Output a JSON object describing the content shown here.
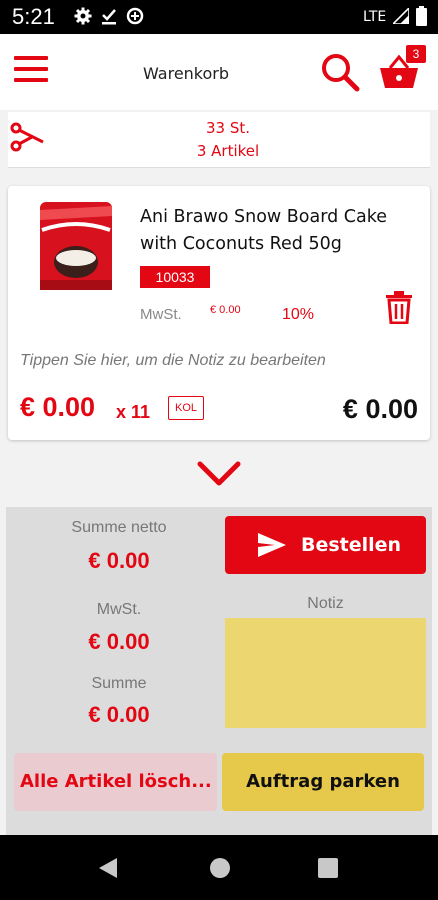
{
  "status_bar": {
    "time": "5:21",
    "network": "LTE"
  },
  "app_bar": {
    "title": "Warenkorb",
    "cart_count": "3"
  },
  "summary": {
    "quantity": "33 St.",
    "articles": "3 Artikel"
  },
  "product": {
    "name": "Ani Brawo Snow Board Cake with Coconuts Red 50g",
    "code": "10033",
    "vat_label": "MwSt.",
    "vat_amount": "€ 0.00",
    "vat_rate": "10%",
    "note_placeholder": "Tippen Sie hier, um die Notiz zu bearbeiten",
    "unit_price": "€ 0.00",
    "quantity": "x 11",
    "unit": "KOL",
    "line_total": "€ 0.00"
  },
  "totals": {
    "net_label": "Summe netto",
    "net_value": "€ 0.00",
    "vat_label": "MwSt.",
    "vat_value": "€ 0.00",
    "sum_label": "Summe",
    "sum_value": "€ 0.00"
  },
  "actions": {
    "order_label": "Bestellen",
    "note_label": "Notiz",
    "clear_label": "Alle Artikel lösch...",
    "park_label": "Auftrag parken"
  },
  "colors": {
    "brand_red": "#e30613",
    "note_yellow": "#ebd66f",
    "park_yellow": "#e6c94a",
    "clear_pink": "#eacbd0"
  }
}
